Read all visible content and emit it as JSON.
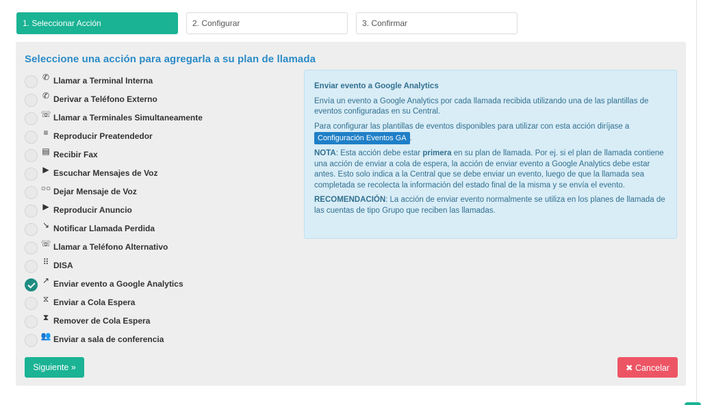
{
  "steps": [
    {
      "label": "1. Seleccionar Acción",
      "active": true
    },
    {
      "label": "2. Configurar",
      "active": false
    },
    {
      "label": "3. Confirmar",
      "active": false
    }
  ],
  "panel": {
    "title": "Seleccione una acción para agregarla a su plan de llamada"
  },
  "options": [
    {
      "icon": "phone-icon",
      "glyph": "✆",
      "label": "Llamar a Terminal Interna",
      "checked": false
    },
    {
      "icon": "phone-forward-icon",
      "glyph": "✆",
      "label": "Derivar a Teléfono Externo",
      "checked": false
    },
    {
      "icon": "phone-multi-icon",
      "glyph": "☏",
      "label": "Llamar a Terminales Simultaneamente",
      "checked": false
    },
    {
      "icon": "playlist-icon",
      "glyph": "≡",
      "label": "Reproducir Preatendedor",
      "checked": false
    },
    {
      "icon": "document-icon",
      "glyph": "▤",
      "label": "Recibir Fax",
      "checked": false
    },
    {
      "icon": "play-icon",
      "glyph": "▶",
      "label": "Escuchar Mensajes de Voz",
      "checked": false
    },
    {
      "icon": "voicemail-icon",
      "glyph": "○○",
      "label": "Dejar Mensaje de Voz",
      "checked": false
    },
    {
      "icon": "play-icon",
      "glyph": "▶",
      "label": "Reproducir Anuncio",
      "checked": false
    },
    {
      "icon": "missed-call-icon",
      "glyph": "↘",
      "label": "Notificar Llamada Perdida",
      "checked": false
    },
    {
      "icon": "phone-alt-icon",
      "glyph": "☏",
      "label": "Llamar a Teléfono Alternativo",
      "checked": false
    },
    {
      "icon": "dialpad-icon",
      "glyph": "⠿",
      "label": "DISA",
      "checked": false
    },
    {
      "icon": "trend-arrow-icon",
      "glyph": "↗",
      "label": "Enviar evento a Google Analytics",
      "checked": true
    },
    {
      "icon": "hourglass-icon",
      "glyph": "⧖",
      "label": "Enviar a Cola Espera",
      "checked": false
    },
    {
      "icon": "hourglass-filled-icon",
      "glyph": "⧗",
      "label": "Remover de Cola Espera",
      "checked": false
    },
    {
      "icon": "group-icon",
      "glyph": "👥",
      "label": "Enviar a sala de conferencia",
      "checked": false
    }
  ],
  "info": {
    "title": "Enviar evento a Google Analytics",
    "p1": "Envía un evento a Google Analytics por cada llamada recibida utilizando una de las plantillas de eventos configuradas en su Central.",
    "p2_before": "Para configurar las plantillas de eventos disponibles para utilizar con esta acción diríjase a",
    "p2_link": "Configuración Eventos GA",
    "p2_after": ".",
    "nota_label": "NOTA",
    "nota_a": ": Esta acción debe estar ",
    "nota_bold": "primera",
    "nota_b": " en su plan de llamada. Por ej. si el plan de llamada contiene una acción de enviar a cola de espera, la acción de enviar evento a Google Analytics debe estar antes. Esto solo indica a la Central que se debe enviar un evento, luego de que la llamada sea completada se recolecta la información del estado final de la misma y se envía el evento.",
    "rec_label": "RECOMENDACIÓN",
    "rec_text": ": La acción de enviar evento normalmente se utiliza en los planes de llamada de las cuentas de tipo Grupo que reciben las llamadas."
  },
  "buttons": {
    "next": "Siguiente »",
    "cancel": "✖ Cancelar"
  },
  "colors": {
    "accent": "#1ab394",
    "danger": "#ed5565",
    "title": "#2a8bc7",
    "info_bg": "#d9edf7"
  }
}
